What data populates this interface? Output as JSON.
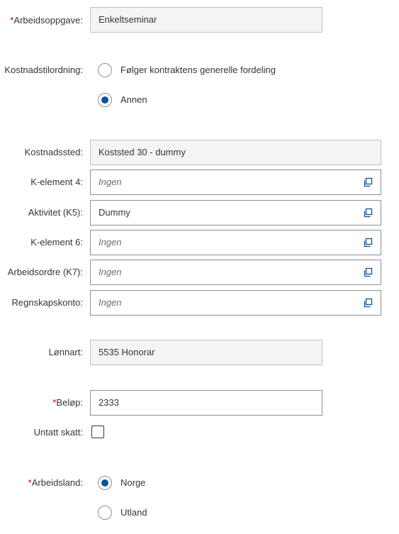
{
  "form": {
    "arbeidsoppgave": {
      "required_mark": "*",
      "label": "Arbeidsoppgave:",
      "value": "Enkeltseminar"
    },
    "kostnadstilordning": {
      "label": "Kostnadstilordning:",
      "options": [
        {
          "label": "Følger kontraktens generelle fordeling",
          "selected": false
        },
        {
          "label": "Annen",
          "selected": true
        }
      ]
    },
    "kostnadssted": {
      "label": "Kostnadssted:",
      "value": "Koststed 30 - dummy"
    },
    "k_element_4": {
      "label": "K-element 4:",
      "placeholder": "Ingen",
      "value_help_icon": "value-help-icon"
    },
    "aktivitet": {
      "label": "Aktivitet (K5):",
      "value": "Dummy",
      "value_help_icon": "value-help-icon"
    },
    "k_element_6": {
      "label": "K-element 6:",
      "placeholder": "Ingen",
      "value_help_icon": "value-help-icon"
    },
    "arbeidsordre": {
      "label": "Arbeidsordre (K7):",
      "placeholder": "Ingen",
      "value_help_icon": "value-help-icon"
    },
    "regnskapskonto": {
      "label": "Regnskapskonto:",
      "placeholder": "Ingen",
      "value_help_icon": "value-help-icon"
    },
    "lonnart": {
      "label": "Lønnart:",
      "value": "5535 Honorar"
    },
    "belop": {
      "required_mark": "*",
      "label": "Beløp:",
      "value": "2333"
    },
    "untatt_skatt": {
      "label": "Untatt skatt:",
      "checked": false
    },
    "arbeidsland": {
      "required_mark": "*",
      "label": "Arbeidsland:",
      "options": [
        {
          "label": "Norge",
          "selected": true
        },
        {
          "label": "Utland",
          "selected": false
        }
      ]
    }
  },
  "colors": {
    "required": "#bb0000",
    "radio_selected": "#0854a0",
    "readonly_bg": "#f4f4f4"
  }
}
